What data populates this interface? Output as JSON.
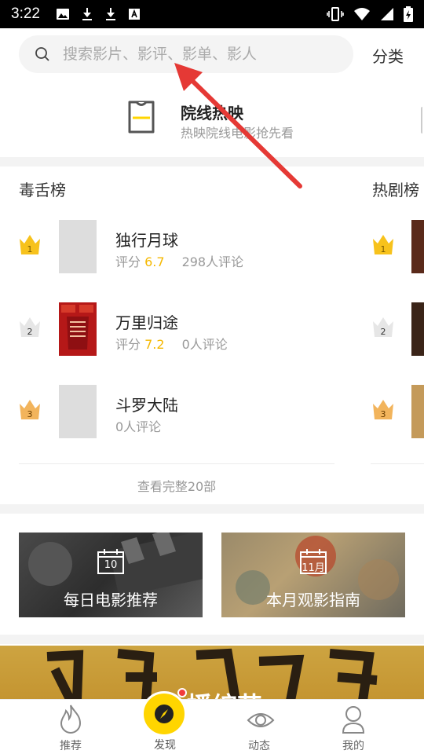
{
  "status_bar": {
    "time": "3:22",
    "left_icons": [
      "image-icon",
      "download-icon",
      "download-icon",
      "text-a-icon"
    ],
    "right_icons": [
      "vibrate-icon",
      "wifi-icon",
      "signal-icon",
      "battery-charging-icon"
    ]
  },
  "search": {
    "placeholder": "搜索影片、影评、影单、影人",
    "category_label": "分类"
  },
  "now_showing": {
    "title": "院线热映",
    "subtitle": "热映院线电影抢先看",
    "icon": "ticket-icon"
  },
  "rankings": {
    "main": {
      "title": "毒舌榜",
      "items": [
        {
          "rank": "1",
          "name": "独行月球",
          "score_label": "评分",
          "score": "6.7",
          "reviews": "298人评论"
        },
        {
          "rank": "2",
          "name": "万里归途",
          "score_label": "评分",
          "score": "7.2",
          "reviews": "0人评论"
        },
        {
          "rank": "3",
          "name": "斗罗大陆",
          "reviews": "0人评论"
        }
      ],
      "view_all": "查看完整20部"
    },
    "secondary": {
      "title": "热剧榜",
      "ranks": [
        "1",
        "2",
        "3"
      ]
    }
  },
  "recommendations": [
    {
      "label": "每日电影推荐",
      "date": "10"
    },
    {
      "label": "本月观影指南",
      "date": "11月"
    }
  ],
  "banner": {
    "title": "播综艺"
  },
  "bottom_nav": [
    {
      "label": "推荐",
      "icon": "fire-icon"
    },
    {
      "label": "发现",
      "icon": "compass-icon"
    },
    {
      "label": "动态",
      "icon": "eye-icon"
    },
    {
      "label": "我的",
      "icon": "profile-icon"
    }
  ],
  "colors": {
    "accent": "#ffd500",
    "score": "#f5b800",
    "annotation_arrow": "#e53935",
    "gold_crown": "#f7c21c",
    "silver_crown": "#e6e6e6",
    "bronze_crown": "#f2b45c"
  }
}
